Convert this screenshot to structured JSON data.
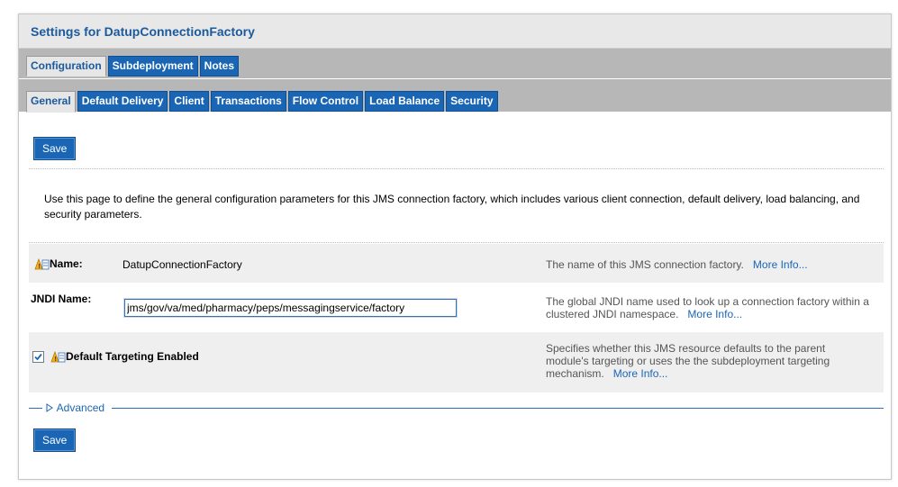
{
  "title": "Settings for DatupConnectionFactory",
  "tabs_top": [
    "Configuration",
    "Subdeployment",
    "Notes"
  ],
  "tabs_sub": [
    "General",
    "Default Delivery",
    "Client",
    "Transactions",
    "Flow Control",
    "Load Balance",
    "Security"
  ],
  "buttons": {
    "save_top": "Save",
    "save_bottom": "Save"
  },
  "intro": "Use this page to define the general configuration parameters for this JMS connection factory, which includes various client connection, default delivery, load balancing, and security parameters.",
  "fields": {
    "name": {
      "label": "Name:",
      "value": "DatupConnectionFactory",
      "help": "The name of this JMS connection factory.",
      "more": "More Info..."
    },
    "jndi": {
      "label": "JNDI Name:",
      "value": "jms/gov/va/med/pharmacy/peps/messagingservice/factory",
      "help": "The global JNDI name used to look up a connection factory within a clustered JNDI namespace.",
      "more": "More Info..."
    },
    "targeting": {
      "label": "Default Targeting Enabled",
      "checked": true,
      "help": "Specifies whether this JMS resource defaults to the parent module's targeting or uses the the subdeployment targeting mechanism.",
      "more": "More Info..."
    }
  },
  "advanced": "Advanced",
  "icons": {
    "attribute": "dynamic-attribute-icon",
    "expand": "triangle-right-icon",
    "check": "checkmark-icon"
  },
  "colors": {
    "accent": "#1a66b5",
    "title": "#1b5a9c",
    "tabbar": "#b7b7b7"
  }
}
